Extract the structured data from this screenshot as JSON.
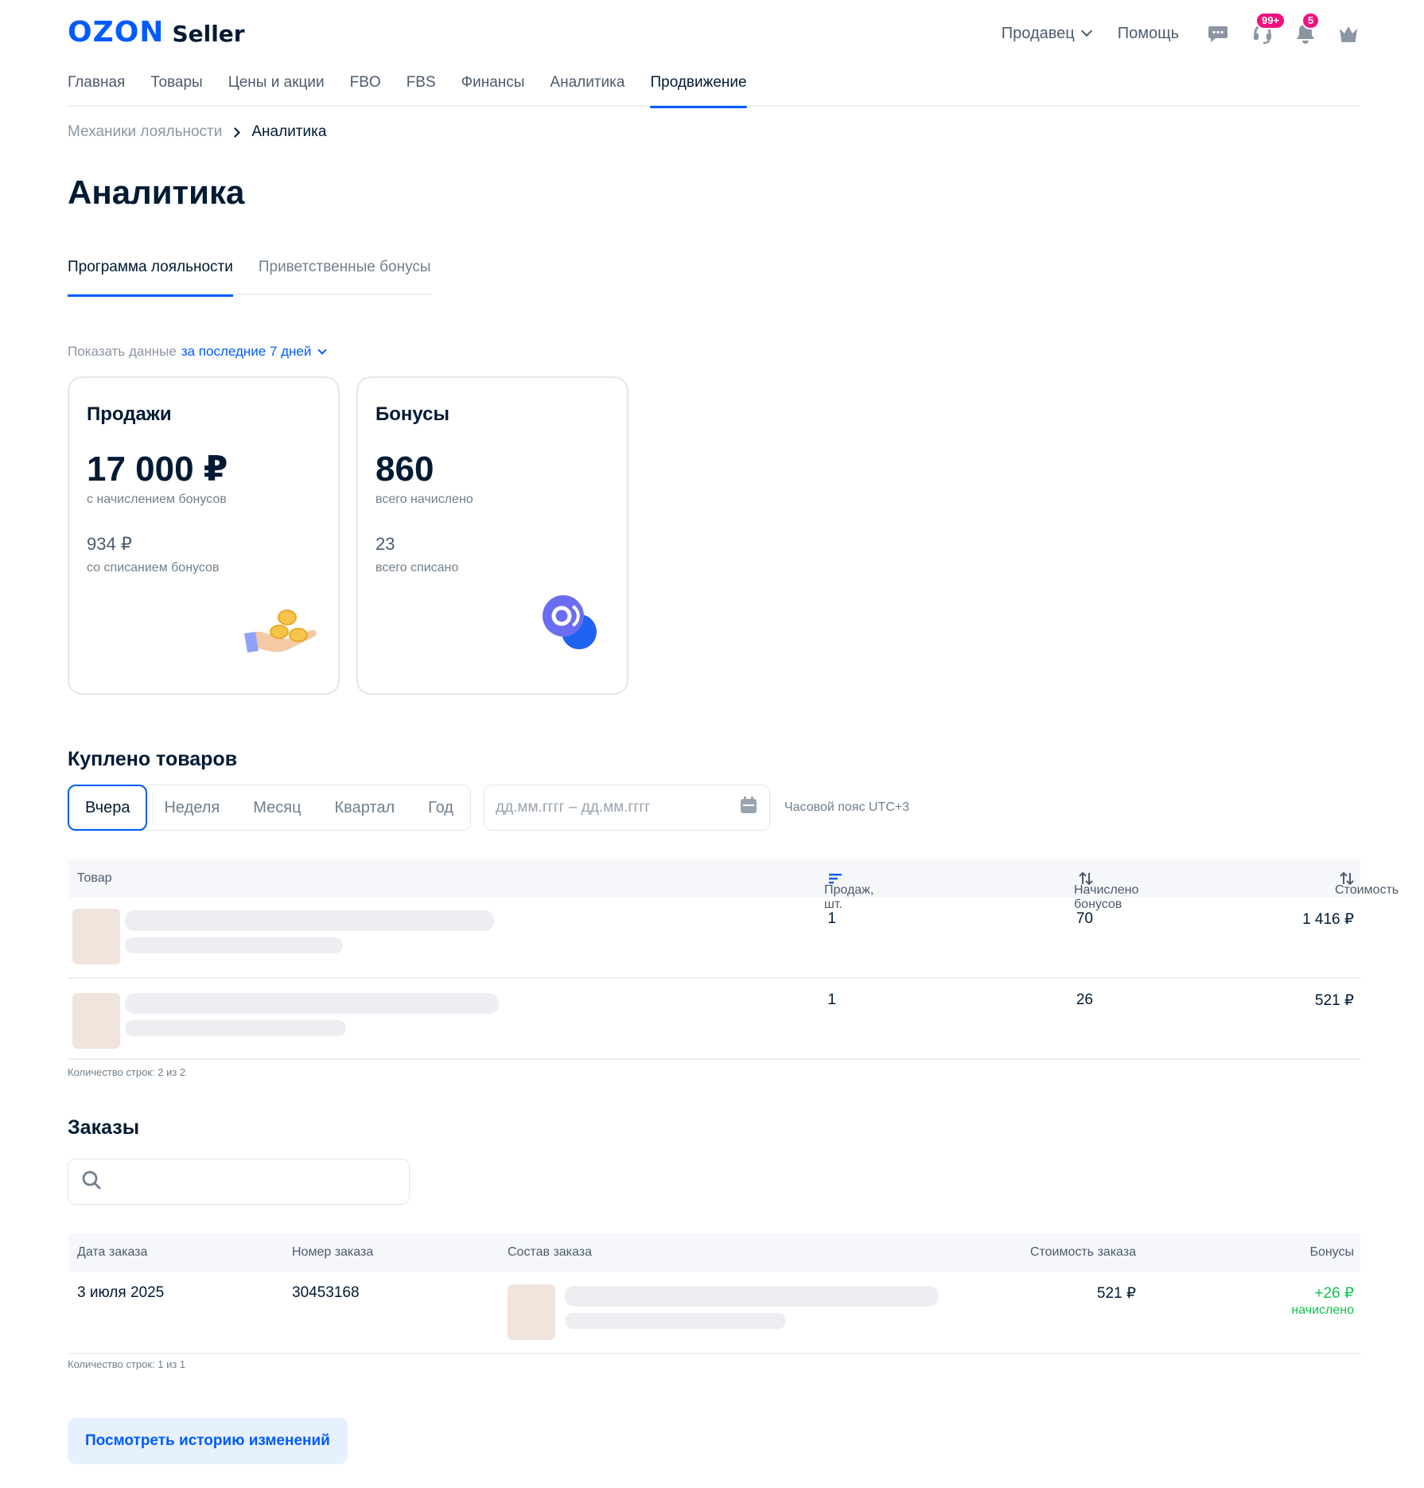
{
  "header": {
    "logo_brand": "OZON",
    "logo_product": "Seller",
    "seller_label": "Продавец",
    "help_label": "Помощь",
    "support_badge": "99+",
    "notifications_badge": "5"
  },
  "nav": {
    "items": [
      "Главная",
      "Товары",
      "Цены и акции",
      "FBO",
      "FBS",
      "Финансы",
      "Аналитика",
      "Продвижение"
    ],
    "active": "Продвижение"
  },
  "breadcrumb": {
    "parent": "Механики лояльности",
    "current": "Аналитика"
  },
  "page": {
    "title": "Аналитика"
  },
  "tabs": {
    "items": [
      "Программа лояльности",
      "Приветственные бонусы"
    ],
    "active": "Программа лояльности"
  },
  "period": {
    "label": "Показать данные",
    "value": "за последние 7 дней"
  },
  "cards": {
    "sales": {
      "title": "Продажи",
      "main_value": "17 000 ₽",
      "main_caption": "с начислением бонусов",
      "secondary_value": "934 ₽",
      "secondary_caption": "со списанием бонусов"
    },
    "bonuses": {
      "title": "Бонусы",
      "main_value": "860",
      "main_caption": "всего начислено",
      "secondary_value": "23",
      "secondary_caption": "всего списано"
    }
  },
  "purchased": {
    "title": "Куплено товаров",
    "periods": [
      "Вчера",
      "Неделя",
      "Месяц",
      "Квартал",
      "Год"
    ],
    "active_period": "Вчера",
    "date_placeholder": "дд.мм.гггг – дд.мм.гггг",
    "timezone": "Часовой пояс UTC+3",
    "columns": {
      "product": "Товар",
      "sales": "Продаж, шт.",
      "bonuses": "Начислено бонусов",
      "cost": "Стоимость"
    },
    "rows": [
      {
        "sales": "1",
        "bonuses": "70",
        "cost": "1 416 ₽"
      },
      {
        "sales": "1",
        "bonuses": "26",
        "cost": "521 ₽"
      }
    ],
    "row_count": "Количество строк: 2 из 2"
  },
  "orders": {
    "title": "Заказы",
    "search_value": "",
    "columns": {
      "date": "Дата заказа",
      "number": "Номер заказа",
      "content": "Состав заказа",
      "cost": "Стоимость заказа",
      "bonuses": "Бонусы"
    },
    "rows": [
      {
        "date": "3 июля 2025",
        "number": "30453168",
        "cost": "521 ₽",
        "bonus_value": "+26 ₽",
        "bonus_status": "начислено"
      }
    ],
    "row_count": "Количество строк: 1 из 1"
  },
  "history_button": "Посмотреть историю изменений",
  "colors": {
    "accent": "#005bff",
    "badge": "#f1117e",
    "positive": "#10c44c",
    "thumb": "#f1e4dd"
  }
}
